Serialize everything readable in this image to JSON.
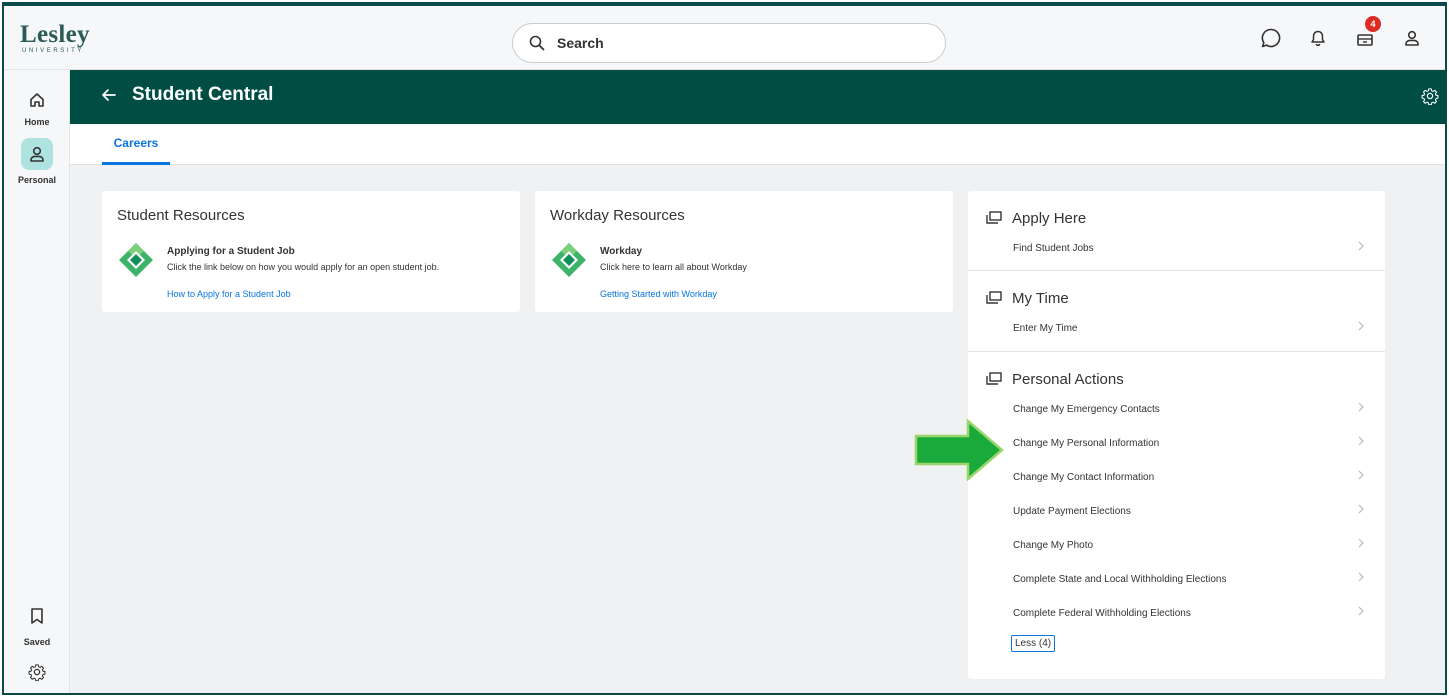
{
  "brand": {
    "name": "Lesley",
    "sub": "UNIVERSITY",
    "color": "#2b5a57"
  },
  "search": {
    "placeholder": "Search",
    "icon": "search-icon"
  },
  "topbar": {
    "icons": [
      "chat-icon",
      "notifications-bell-icon",
      "inbox-icon",
      "profile-icon"
    ],
    "inbox_badge": "4"
  },
  "nav": {
    "home_label": "Home",
    "personal_label": "Personal",
    "saved_label": "Saved"
  },
  "header": {
    "title": "Student Central",
    "band_color": "#004d44"
  },
  "tabs": [
    {
      "label": "Careers",
      "active": true
    }
  ],
  "cards": {
    "student_resources": {
      "title": "Student Resources",
      "item_name": "Applying for a Student Job",
      "item_desc": "Click the link below on how you would apply for an open student job.",
      "link": "How to Apply for a Student Job"
    },
    "workday_resources": {
      "title": "Workday Resources",
      "item_name": "Workday",
      "item_desc": "Click here to learn all about Workday",
      "link": "Getting Started with Workday"
    }
  },
  "right_panel": {
    "apply_here": {
      "title": "Apply Here",
      "items": [
        "Find Student Jobs"
      ]
    },
    "my_time": {
      "title": "My Time",
      "items": [
        "Enter My Time"
      ]
    },
    "personal_actions": {
      "title": "Personal Actions",
      "items": [
        "Change My Emergency Contacts",
        "Change My Personal Information",
        "Change My Contact Information",
        "Update Payment Elections",
        "Change My Photo",
        "Complete State and Local Withholding Elections",
        "Complete Federal Withholding Elections"
      ],
      "less_button": "Less (4)"
    }
  },
  "colors": {
    "accent": "#0875e1",
    "badge": "#de2b24",
    "arrow": "#1aaa3c"
  }
}
